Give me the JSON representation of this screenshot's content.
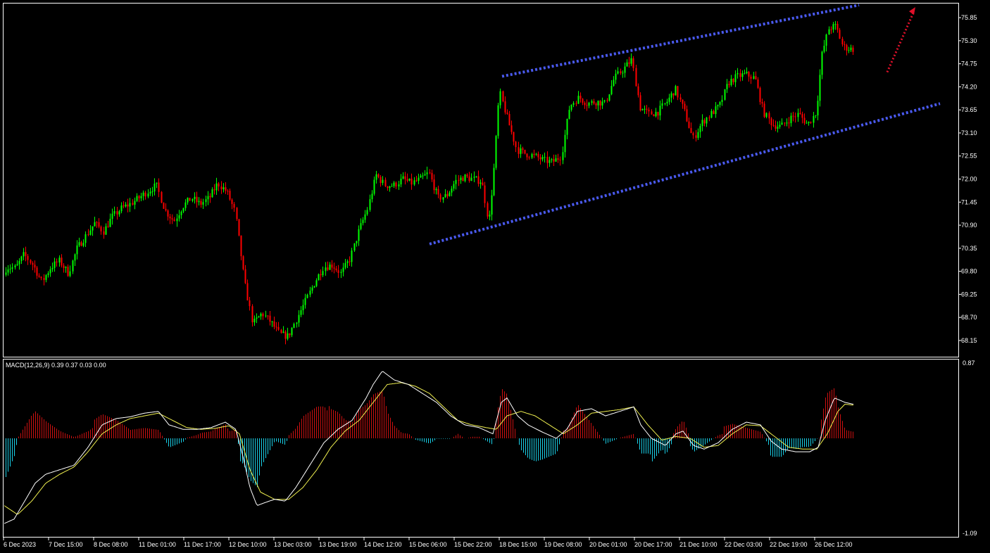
{
  "chart_data": [
    {
      "type": "candlestick",
      "panel": "price",
      "colors": {
        "bull": "#00ff00",
        "bear": "#ff0000",
        "channel": "#4a5af0",
        "arrow": "#e0102a"
      },
      "yticks": [
        "75.85",
        "75.30",
        "74.75",
        "74.20",
        "73.65",
        "73.10",
        "72.55",
        "72.00",
        "71.45",
        "70.90",
        "70.35",
        "69.80",
        "69.25",
        "68.70",
        "68.15"
      ],
      "ylim": [
        67.78,
        76.17
      ],
      "anchors": [
        [
          0,
          69.35
        ],
        [
          12,
          69.9
        ],
        [
          25,
          69.88
        ],
        [
          37,
          70.2
        ],
        [
          50,
          69.95
        ],
        [
          62,
          69.55
        ],
        [
          75,
          69.9
        ],
        [
          87,
          70.05
        ],
        [
          100,
          69.75
        ],
        [
          112,
          70.35
        ],
        [
          125,
          70.65
        ],
        [
          137,
          70.95
        ],
        [
          150,
          70.75
        ],
        [
          162,
          71.1
        ],
        [
          175,
          71.3
        ],
        [
          187,
          71.4
        ],
        [
          200,
          71.55
        ],
        [
          212,
          71.7
        ],
        [
          225,
          71.85
        ],
        [
          237,
          71.25
        ],
        [
          250,
          71.0
        ],
        [
          262,
          71.35
        ],
        [
          275,
          71.55
        ],
        [
          287,
          71.4
        ],
        [
          300,
          71.55
        ],
        [
          312,
          71.9
        ],
        [
          325,
          71.7
        ],
        [
          337,
          71.2
        ],
        [
          350,
          69.55
        ],
        [
          362,
          68.55
        ],
        [
          375,
          68.8
        ],
        [
          387,
          68.6
        ],
        [
          400,
          68.3
        ],
        [
          412,
          68.25
        ],
        [
          425,
          68.7
        ],
        [
          437,
          69.1
        ],
        [
          450,
          69.55
        ],
        [
          462,
          69.9
        ],
        [
          475,
          69.95
        ],
        [
          487,
          69.75
        ],
        [
          500,
          70.1
        ],
        [
          512,
          70.75
        ],
        [
          525,
          71.3
        ],
        [
          537,
          72.1
        ],
        [
          550,
          71.85
        ],
        [
          562,
          71.85
        ],
        [
          575,
          72.0
        ],
        [
          587,
          71.9
        ],
        [
          600,
          72.0
        ],
        [
          612,
          72.15
        ],
        [
          625,
          71.55
        ],
        [
          637,
          71.6
        ],
        [
          650,
          71.95
        ],
        [
          662,
          72.05
        ],
        [
          675,
          72.0
        ],
        [
          687,
          71.95
        ],
        [
          697,
          70.95
        ],
        [
          705,
          72.4
        ],
        [
          712,
          74.1
        ],
        [
          725,
          73.35
        ],
        [
          737,
          72.7
        ],
        [
          750,
          72.6
        ],
        [
          762,
          72.55
        ],
        [
          775,
          72.45
        ],
        [
          787,
          72.4
        ],
        [
          800,
          72.55
        ],
        [
          812,
          73.75
        ],
        [
          825,
          73.95
        ],
        [
          837,
          73.8
        ],
        [
          850,
          73.85
        ],
        [
          862,
          73.8
        ],
        [
          875,
          74.4
        ],
        [
          887,
          74.6
        ],
        [
          900,
          74.85
        ],
        [
          912,
          73.7
        ],
        [
          925,
          73.55
        ],
        [
          937,
          73.6
        ],
        [
          950,
          73.85
        ],
        [
          962,
          74.15
        ],
        [
          975,
          73.6
        ],
        [
          987,
          72.95
        ],
        [
          1000,
          73.35
        ],
        [
          1012,
          73.55
        ],
        [
          1025,
          73.75
        ],
        [
          1037,
          74.3
        ],
        [
          1050,
          74.45
        ],
        [
          1062,
          74.5
        ],
        [
          1075,
          74.4
        ],
        [
          1087,
          73.6
        ],
        [
          1100,
          73.3
        ],
        [
          1112,
          73.25
        ],
        [
          1125,
          73.45
        ],
        [
          1137,
          73.55
        ],
        [
          1150,
          73.3
        ],
        [
          1162,
          73.6
        ],
        [
          1170,
          74.95
        ],
        [
          1180,
          75.6
        ],
        [
          1190,
          75.65
        ],
        [
          1200,
          75.15
        ],
        [
          1212,
          75.1
        ]
      ],
      "channel_upper": [
        [
          713,
          74.45
        ],
        [
          1220,
          76.15
        ]
      ],
      "channel_lower": [
        [
          610,
          70.45
        ],
        [
          1335,
          73.8
        ]
      ],
      "trend_arrow": [
        [
          1260,
          74.55
        ],
        [
          1300,
          76.1
        ]
      ]
    },
    {
      "type": "macd",
      "panel": "indicator",
      "title": "MACD(12,26,9) 0.39 0.37 0.03 0.00",
      "yticks": [
        "0.87",
        "-1.09"
      ],
      "ylim": [
        -1.09,
        0.87
      ],
      "colors": {
        "pos_hist": "#cc1010",
        "neg_hist": "#19d0e8",
        "macd_line": "#ffffff",
        "signal_line": "#f0f050"
      },
      "macd_line": [
        [
          6,
          -0.95
        ],
        [
          20,
          -0.9
        ],
        [
          35,
          -0.7
        ],
        [
          50,
          -0.5
        ],
        [
          65,
          -0.4
        ],
        [
          85,
          -0.35
        ],
        [
          105,
          -0.3
        ],
        [
          125,
          -0.1
        ],
        [
          145,
          0.15
        ],
        [
          165,
          0.22
        ],
        [
          185,
          0.24
        ],
        [
          205,
          0.28
        ],
        [
          225,
          0.3
        ],
        [
          240,
          0.15
        ],
        [
          260,
          0.1
        ],
        [
          280,
          0.1
        ],
        [
          300,
          0.12
        ],
        [
          320,
          0.18
        ],
        [
          335,
          0.1
        ],
        [
          345,
          -0.2
        ],
        [
          355,
          -0.55
        ],
        [
          365,
          -0.75
        ],
        [
          375,
          -0.72
        ],
        [
          390,
          -0.68
        ],
        [
          405,
          -0.7
        ],
        [
          420,
          -0.55
        ],
        [
          440,
          -0.3
        ],
        [
          460,
          -0.05
        ],
        [
          480,
          0.1
        ],
        [
          500,
          0.2
        ],
        [
          520,
          0.45
        ],
        [
          530,
          0.6
        ],
        [
          543,
          0.75
        ],
        [
          560,
          0.65
        ],
        [
          580,
          0.6
        ],
        [
          600,
          0.5
        ],
        [
          620,
          0.4
        ],
        [
          640,
          0.25
        ],
        [
          660,
          0.15
        ],
        [
          680,
          0.12
        ],
        [
          700,
          0.05
        ],
        [
          712,
          0.4
        ],
        [
          720,
          0.45
        ],
        [
          735,
          0.25
        ],
        [
          750,
          0.15
        ],
        [
          770,
          0.07
        ],
        [
          790,
          0.0
        ],
        [
          805,
          0.1
        ],
        [
          820,
          0.3
        ],
        [
          840,
          0.33
        ],
        [
          860,
          0.25
        ],
        [
          880,
          0.3
        ],
        [
          900,
          0.35
        ],
        [
          910,
          0.15
        ],
        [
          925,
          0.0
        ],
        [
          945,
          -0.08
        ],
        [
          960,
          0.05
        ],
        [
          970,
          0.08
        ],
        [
          985,
          -0.08
        ],
        [
          1000,
          -0.12
        ],
        [
          1020,
          -0.05
        ],
        [
          1040,
          0.1
        ],
        [
          1060,
          0.18
        ],
        [
          1080,
          0.15
        ],
        [
          1095,
          -0.03
        ],
        [
          1110,
          -0.12
        ],
        [
          1130,
          -0.15
        ],
        [
          1150,
          -0.15
        ],
        [
          1162,
          -0.1
        ],
        [
          1172,
          0.2
        ],
        [
          1185,
          0.45
        ],
        [
          1200,
          0.4
        ],
        [
          1212,
          0.38
        ]
      ],
      "signal_line": [
        [
          6,
          -0.75
        ],
        [
          25,
          -0.85
        ],
        [
          45,
          -0.7
        ],
        [
          65,
          -0.5
        ],
        [
          85,
          -0.4
        ],
        [
          105,
          -0.32
        ],
        [
          125,
          -0.15
        ],
        [
          145,
          0.05
        ],
        [
          165,
          0.15
        ],
        [
          185,
          0.22
        ],
        [
          205,
          0.25
        ],
        [
          225,
          0.28
        ],
        [
          245,
          0.2
        ],
        [
          265,
          0.12
        ],
        [
          285,
          0.1
        ],
        [
          305,
          0.11
        ],
        [
          325,
          0.14
        ],
        [
          340,
          0.05
        ],
        [
          355,
          -0.35
        ],
        [
          370,
          -0.6
        ],
        [
          390,
          -0.68
        ],
        [
          410,
          -0.68
        ],
        [
          430,
          -0.55
        ],
        [
          450,
          -0.35
        ],
        [
          470,
          -0.1
        ],
        [
          490,
          0.08
        ],
        [
          510,
          0.2
        ],
        [
          530,
          0.4
        ],
        [
          550,
          0.6
        ],
        [
          570,
          0.62
        ],
        [
          590,
          0.58
        ],
        [
          610,
          0.5
        ],
        [
          630,
          0.35
        ],
        [
          650,
          0.2
        ],
        [
          670,
          0.15
        ],
        [
          690,
          0.12
        ],
        [
          705,
          0.1
        ],
        [
          720,
          0.25
        ],
        [
          740,
          0.3
        ],
        [
          760,
          0.25
        ],
        [
          780,
          0.15
        ],
        [
          800,
          0.05
        ],
        [
          820,
          0.15
        ],
        [
          840,
          0.28
        ],
        [
          860,
          0.3
        ],
        [
          880,
          0.32
        ],
        [
          900,
          0.35
        ],
        [
          920,
          0.15
        ],
        [
          940,
          -0.02
        ],
        [
          960,
          0.02
        ],
        [
          980,
          0.0
        ],
        [
          1000,
          -0.1
        ],
        [
          1020,
          -0.08
        ],
        [
          1040,
          0.05
        ],
        [
          1060,
          0.15
        ],
        [
          1080,
          0.14
        ],
        [
          1100,
          0.02
        ],
        [
          1120,
          -0.1
        ],
        [
          1140,
          -0.12
        ],
        [
          1160,
          -0.12
        ],
        [
          1175,
          0.05
        ],
        [
          1190,
          0.3
        ],
        [
          1200,
          0.38
        ],
        [
          1212,
          0.37
        ]
      ]
    }
  ],
  "time_axis": {
    "labels": [
      "6 Dec 2023",
      "7 Dec 15:00",
      "8 Dec 08:00",
      "11 Dec 01:00",
      "11 Dec 17:00",
      "12 Dec 10:00",
      "13 Dec 03:00",
      "13 Dec 19:00",
      "14 Dec 12:00",
      "15 Dec 06:00",
      "15 Dec 22:00",
      "18 Dec 15:00",
      "19 Dec 08:00",
      "20 Dec 01:00",
      "20 Dec 17:00",
      "21 Dec 10:00",
      "22 Dec 03:00",
      "22 Dec 19:00",
      "26 Dec 12:00"
    ]
  }
}
